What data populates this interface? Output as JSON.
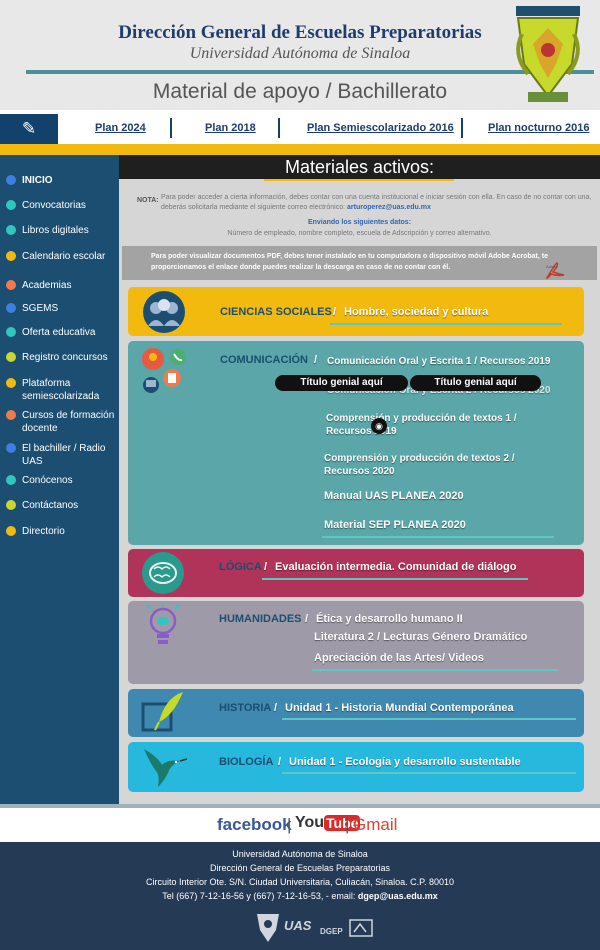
{
  "header": {
    "title": "Dirección General de Escuelas Preparatorias",
    "subtitle": "Universidad Autónoma de Sinaloa",
    "material": "Material de apoyo  / Bachillerato"
  },
  "plans": [
    "Plan 2024",
    "Plan 2018",
    "Plan Semiescolarizado 2016",
    "Plan nocturno 2016"
  ],
  "sidebar": {
    "items": [
      {
        "label": "INICIO",
        "color": "#3f7fe0"
      },
      {
        "label": "Convocatorias",
        "color": "#2fc6c0"
      },
      {
        "label": "Libros digitales",
        "color": "#2fc6c0"
      },
      {
        "label": "Calendario escolar",
        "color": "#f2ba0e"
      },
      {
        "label": "Academias",
        "color": "#f07a4a"
      },
      {
        "label": "SGEMS",
        "color": "#3f7fe0"
      },
      {
        "label": "Oferta educativa",
        "color": "#2fc6c0"
      },
      {
        "label": "Registro concursos",
        "color": "#c7d92a"
      },
      {
        "label": "Plataforma semiescolarizada",
        "color": "#f2ba0e"
      },
      {
        "label": "Cursos de formación docente",
        "color": "#f07a4a"
      },
      {
        "label": "El bachiller / Radio UAS",
        "color": "#3f7fe0"
      },
      {
        "label": "Conócenos",
        "color": "#2fc6c0"
      },
      {
        "label": "Contáctanos",
        "color": "#c7d92a"
      },
      {
        "label": "Directorio",
        "color": "#f2ba0e"
      }
    ]
  },
  "main": {
    "heading": "Materiales activos:",
    "nota_label": "NOTA:",
    "nota_text": "Para poder acceder a cierta información, debes contar con una cuenta institucional e iniciar sesión con ella. En caso de no contar con una, deberás solicitarla mediante el siguiente correo electrónico:",
    "nota_email": "arturoperez@uas.edu.mx",
    "datos_title": "Enviando los siguientes datos:",
    "datos_text": "Número de empleado, nombre completo, escuela de Adscripción y correo alternativo.",
    "pdf_text": "Para poder visualizar documentos PDF, debes tener instalado en tu computadora o dispositivo móvil Adobe Acrobat, te proporcionamos el enlace donde puedes realizar la descarga en caso de no contar con él.",
    "pdf_icon_label": "Adobe"
  },
  "cards": {
    "sociales": {
      "title": "CIENCIAS SOCIALES",
      "sep": "/",
      "link": "Hombre, sociedad y cultura",
      "color": "#f2ba0e"
    },
    "comunicacion": {
      "title": "COMUNICACIÓN",
      "sep": "/",
      "link1": "Comunicación Oral y Escrita 1 / Recursos 2019",
      "link1_ghost": "Comunicación Oral y Escrita 2 / Recursos 2020",
      "pill1": "Título genial aquí",
      "pill2": "Título genial aquí",
      "link3": "Comprensión y producción de textos 1 / Recursos 2019",
      "link4": "Comprensión y producción de textos 2 / Recursos 2020",
      "link5": "Manual UAS PLANEA 2020",
      "link6": "Material SEP PLANEA 2020",
      "color": "#5aa6a8"
    },
    "logica": {
      "title": "LÓGICA",
      "sep": "/",
      "link": "Evaluación intermedia. Comunidad de diálogo",
      "color": "#b03359"
    },
    "humanidades": {
      "title": "HUMANIDADES",
      "sep": "/",
      "link1": "Ética y desarrollo humano II",
      "link2": "Literatura 2 / Lecturas Género Dramático",
      "link3": "Apreciación de las Artes/ Videos",
      "color": "#9e9aa8"
    },
    "historia": {
      "title": "HISTORIA",
      "sep": "/",
      "link": "Unidad 1 - Historia Mundial Contemporánea",
      "color": "#3f88b0"
    },
    "biologia": {
      "title": "BIOLOGÍA",
      "sep": "/",
      "link": "Unidad 1 - Ecología y desarrollo sustentable",
      "color": "#27b8dd"
    }
  },
  "social": {
    "facebook": "facebook",
    "youtube_you": "You",
    "youtube_tube": "Tube",
    "gmail": "Gmail"
  },
  "footer": {
    "line1": "Universidad Autónoma de Sinaloa",
    "line2": "Dirección General de Escuelas Preparatorias",
    "line3": "Circuito Interior Ote. S/N. Ciudad Universitaria, Culiacán, Sinaloa. C.P. 80010",
    "line4": "Tel (667) 7-12-16-56 y (667) 7-12-16-53,  -  email:",
    "email": "dgep@uas.edu.mx",
    "logo_uas": "UAS",
    "logo_dgep": "DGEP"
  }
}
